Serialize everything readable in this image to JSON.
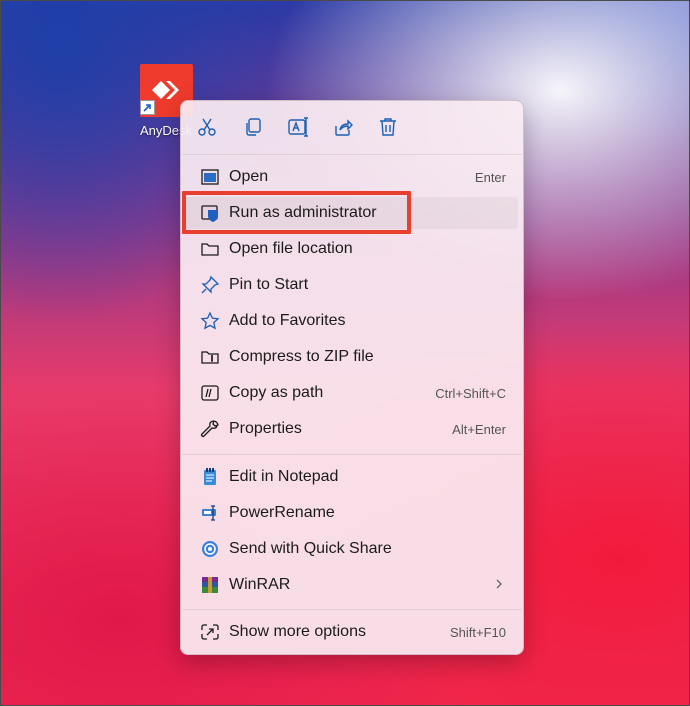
{
  "desktop": {
    "icon_label": "AnyDesk",
    "brand_color": "#ef3b2d"
  },
  "toolbar": [
    {
      "name": "cut-icon"
    },
    {
      "name": "copy-icon"
    },
    {
      "name": "rename-icon"
    },
    {
      "name": "share-icon"
    },
    {
      "name": "delete-icon"
    }
  ],
  "menu": {
    "items": [
      {
        "label": "Open",
        "shortcut": "Enter",
        "icon": "open-window-icon"
      },
      {
        "label": "Run as administrator",
        "shortcut": "",
        "icon": "shield-icon"
      },
      {
        "label": "Open file location",
        "shortcut": "",
        "icon": "folder-icon"
      },
      {
        "label": "Pin to Start",
        "shortcut": "",
        "icon": "pin-icon"
      },
      {
        "label": "Add to Favorites",
        "shortcut": "",
        "icon": "star-icon"
      },
      {
        "label": "Compress to ZIP file",
        "shortcut": "",
        "icon": "zip-folder-icon"
      },
      {
        "label": "Copy as path",
        "shortcut": "Ctrl+Shift+C",
        "icon": "path-icon"
      },
      {
        "label": "Properties",
        "shortcut": "Alt+Enter",
        "icon": "wrench-icon"
      }
    ],
    "apps": [
      {
        "label": "Edit in Notepad",
        "icon": "notepad-icon"
      },
      {
        "label": "PowerRename",
        "icon": "powerrename-icon"
      },
      {
        "label": "Send with Quick Share",
        "icon": "quick-share-icon"
      },
      {
        "label": "WinRAR",
        "icon": "winrar-icon"
      }
    ],
    "more": {
      "label": "Show more options",
      "shortcut": "Shift+F10",
      "icon": "more-options-icon"
    }
  },
  "highlight_color": "#e8402f"
}
